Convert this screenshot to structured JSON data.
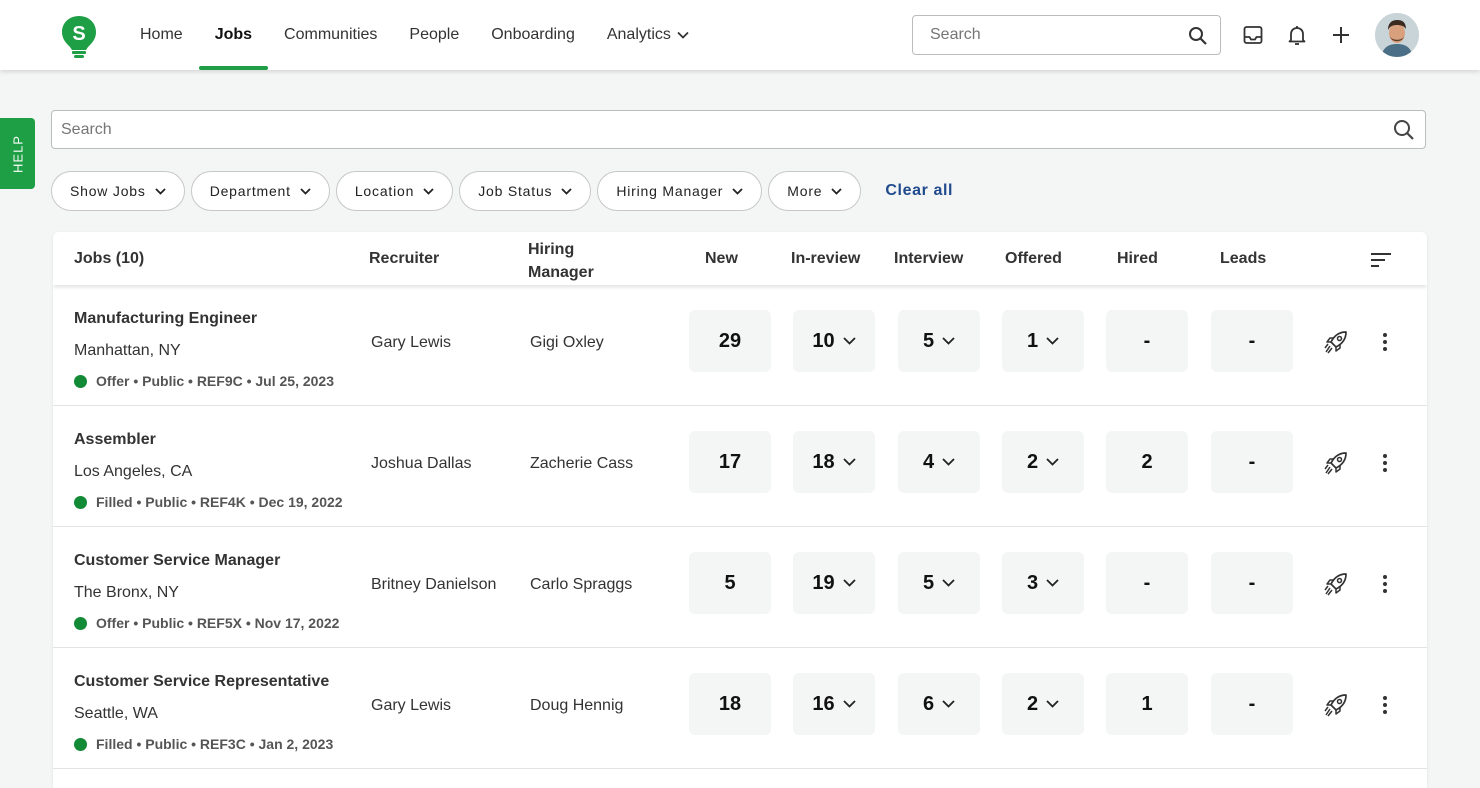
{
  "nav": {
    "logo_letter": "S",
    "items": [
      {
        "label": "Home",
        "active": false
      },
      {
        "label": "Jobs",
        "active": true
      },
      {
        "label": "Communities",
        "active": false
      },
      {
        "label": "People",
        "active": false
      },
      {
        "label": "Onboarding",
        "active": false
      },
      {
        "label": "Analytics",
        "active": false,
        "has_dropdown": true
      }
    ],
    "search_placeholder": "Search",
    "icons": [
      "inbox-icon",
      "bell-icon",
      "plus-icon"
    ]
  },
  "help": {
    "label": "HELP"
  },
  "search": {
    "placeholder": "Search"
  },
  "filters": {
    "chips": [
      "Show Jobs",
      "Department",
      "Location",
      "Job Status",
      "Hiring Manager",
      "More"
    ],
    "clear_all": "Clear all"
  },
  "table": {
    "headers": {
      "jobs": "Jobs (10)",
      "recruiter": "Recruiter",
      "hiring_manager_line1": "Hiring",
      "hiring_manager_line2": "Manager",
      "new": "New",
      "in_review": "In-review",
      "interview": "Interview",
      "offered": "Offered",
      "hired": "Hired",
      "leads": "Leads"
    },
    "rows": [
      {
        "title": "Manufacturing Engineer",
        "location": "Manhattan, NY",
        "meta": "Offer • Public • REF9C • Jul 25, 2023",
        "recruiter": "Gary Lewis",
        "manager": "Gigi Oxley",
        "new": "29",
        "in_review": "10",
        "interview": "5",
        "offered": "1",
        "hired": "-",
        "leads": "-"
      },
      {
        "title": "Assembler",
        "location": "Los Angeles, CA",
        "meta": "Filled • Public • REF4K • Dec 19, 2022",
        "recruiter": "Joshua Dallas",
        "manager": "Zacherie Cass",
        "new": "17",
        "in_review": "18",
        "interview": "4",
        "offered": "2",
        "hired": "2",
        "leads": "-"
      },
      {
        "title": "Customer Service Manager",
        "location": "The Bronx, NY",
        "meta": "Offer • Public • REF5X • Nov 17, 2022",
        "recruiter": "Britney Danielson",
        "manager": "Carlo Spraggs",
        "new": "5",
        "in_review": "19",
        "interview": "5",
        "offered": "3",
        "hired": "-",
        "leads": "-"
      },
      {
        "title": "Customer Service Representative",
        "location": "Seattle, WA",
        "meta": "Filled • Public • REF3C • Jan 2, 2023",
        "recruiter": "Gary Lewis",
        "manager": "Doug Hennig",
        "new": "18",
        "in_review": "16",
        "interview": "6",
        "offered": "2",
        "hired": "1",
        "leads": "-"
      }
    ]
  },
  "colors": {
    "brand_green": "#1e9e45",
    "status_dot": "#138a36",
    "link_blue": "#1f4b8e"
  }
}
